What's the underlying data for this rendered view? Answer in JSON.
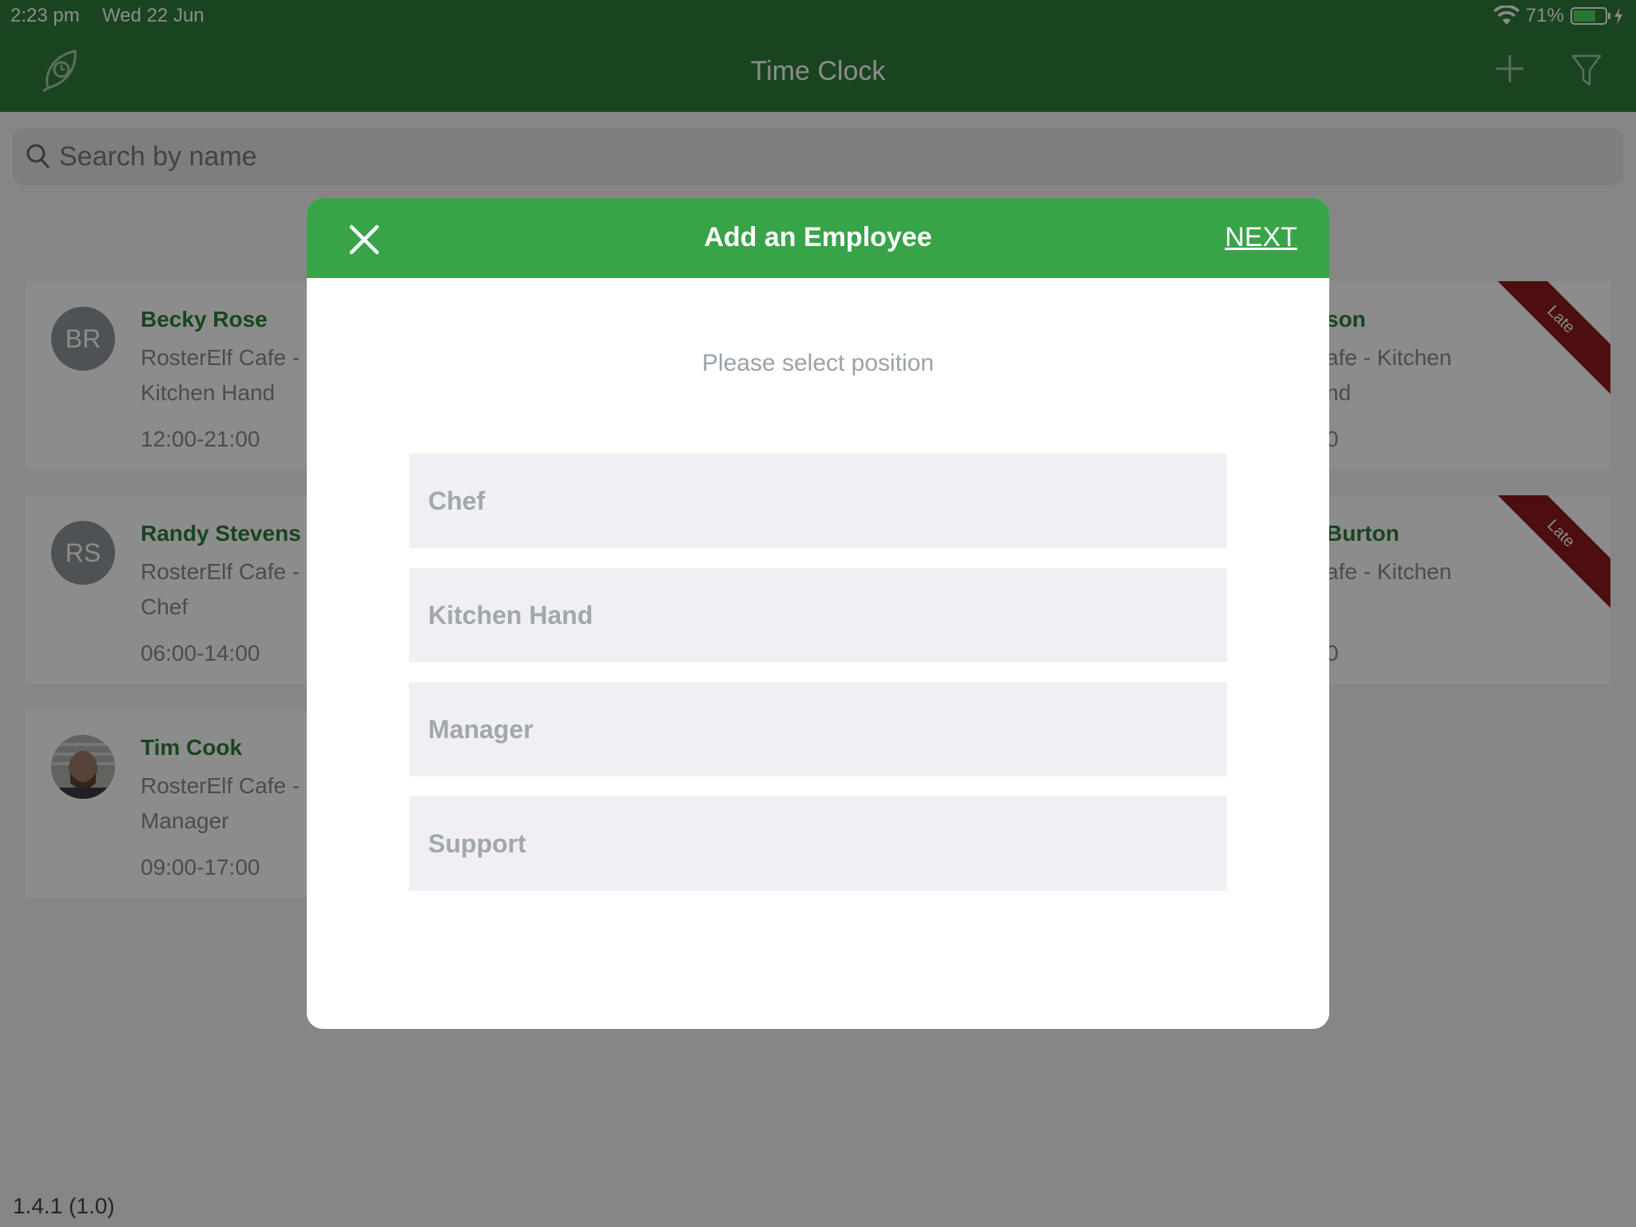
{
  "status_bar": {
    "time": "2:23 pm",
    "date": "Wed 22 Jun",
    "battery_text": "71%",
    "battery_level": 0.71
  },
  "nav": {
    "title": "Time Clock"
  },
  "search": {
    "placeholder": "Search by name"
  },
  "employees": [
    {
      "initials": "BR",
      "name": "Becky Rose",
      "location_line1": "RosterElf Cafe -",
      "location_line2": "Kitchen Hand",
      "shift": "12:00-21:00"
    },
    {
      "initials": "RS",
      "name": "Randy Stevens",
      "location_line1": "RosterElf Cafe -",
      "location_line2": "Chef",
      "shift": "06:00-14:00"
    },
    {
      "initials": "",
      "name": "Tim Cook",
      "location_line1": "RosterElf Cafe -",
      "location_line2": "Manager",
      "shift": "09:00-17:00"
    },
    {
      "name": "son",
      "location_line1": "afe - Kitchen",
      "location_line2": "nd",
      "shift": "0",
      "badge": "Late"
    },
    {
      "name": "Burton",
      "location_line1": "afe - Kitchen",
      "location_line2": "",
      "shift": "0",
      "badge": "Late"
    }
  ],
  "version": "1.4.1 (1.0)",
  "modal": {
    "title": "Add an Employee",
    "next_label": "NEXT",
    "prompt": "Please select position",
    "positions": [
      "Chef",
      "Kitchen Hand",
      "Manager",
      "Support"
    ]
  },
  "colors": {
    "brand_green": "#2e7d3a",
    "modal_header_green": "#37a447",
    "late_ribbon": "#8b1a1a"
  }
}
